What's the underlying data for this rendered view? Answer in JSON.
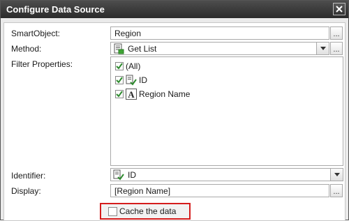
{
  "dialog": {
    "title": "Configure Data Source"
  },
  "smartobject": {
    "label": "SmartObject:",
    "value": "Region",
    "browse_label": "..."
  },
  "method": {
    "label": "Method:",
    "value": "Get List",
    "browse_label": "..."
  },
  "filter": {
    "label": "Filter Properties:",
    "items": [
      {
        "label": "(All)",
        "checked": true,
        "icon": "none"
      },
      {
        "label": "ID",
        "checked": true,
        "icon": "key-property-icon"
      },
      {
        "label": "Region Name",
        "checked": true,
        "icon": "text-property-icon"
      }
    ]
  },
  "identifier": {
    "label": "Identifier:",
    "value": "ID"
  },
  "display": {
    "label": "Display:",
    "value": "[Region Name]",
    "browse_label": "..."
  },
  "cache": {
    "label": "Cache the data",
    "checked": false
  },
  "colors": {
    "title_bar": "#3a3a3a",
    "highlight_border": "#d51c1c",
    "check_green": "#2e8b2e"
  }
}
